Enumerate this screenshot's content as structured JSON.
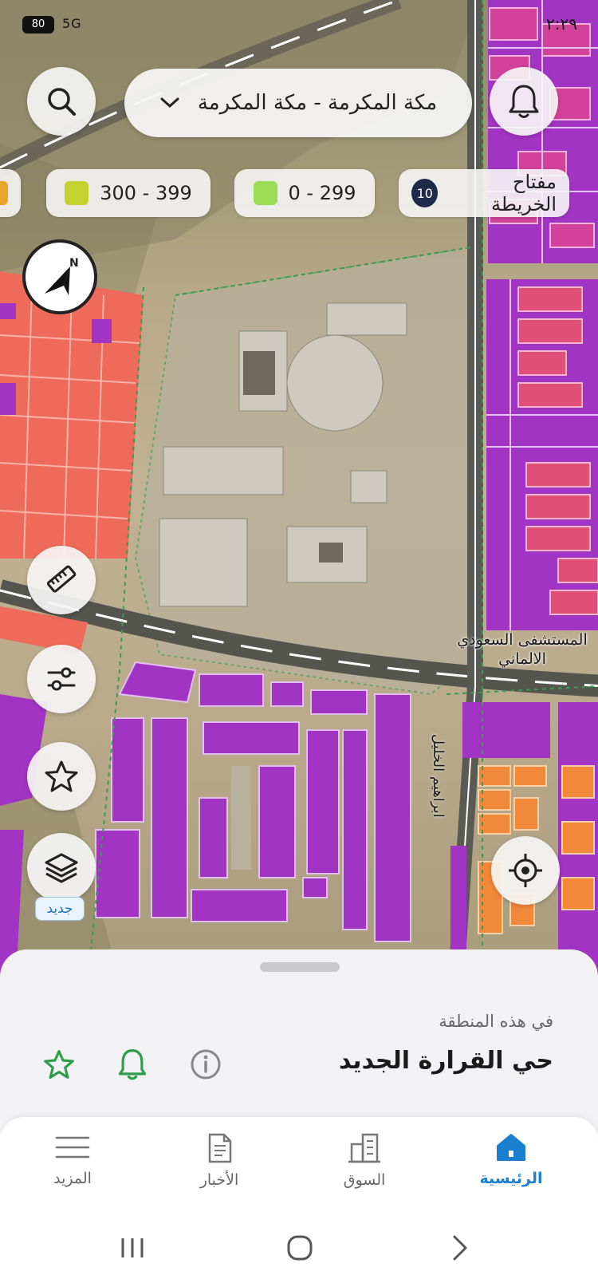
{
  "status_bar": {
    "time": "٢:٢٩",
    "battery": "80",
    "signal": "5G"
  },
  "search": {
    "icon": "search-icon"
  },
  "city_selector": {
    "label": "مكة المكرمة - مكة المكرمة",
    "icon": "chevron-down-icon"
  },
  "notifications": {
    "icon": "bell-icon"
  },
  "legend": {
    "key_label": "مفتاح الخريطة",
    "key_count": "10",
    "ranges": [
      {
        "label": "0 - 299",
        "color": "#9bdc55"
      },
      {
        "label": "300 - 399",
        "color": "#c5d12f"
      }
    ]
  },
  "map": {
    "compass_letter": "N",
    "hospital_label": "المستشفى السعودي الالماني",
    "street_label": "ابراهيم الخليل",
    "colors": {
      "purple": "#a234c4",
      "magenta": "#d2429a",
      "salmon": "#ee6a5a",
      "orange": "#f2883a",
      "zone_border": "#4aa05a"
    }
  },
  "side_tools": {
    "ruler": "ruler-icon",
    "filter": "sliders-icon",
    "favorite": "star-icon",
    "layers": "layers-icon",
    "new_badge": "جديد"
  },
  "locate": {
    "icon": "crosshair-icon"
  },
  "sheet": {
    "subtitle": "في هذه المنطقة",
    "title": "حي القرارة الجديد"
  },
  "tabs": [
    {
      "label": "الرئيسية",
      "icon": "home-icon",
      "active": true
    },
    {
      "label": "السوق",
      "icon": "buildings-icon",
      "active": false
    },
    {
      "label": "الأخبار",
      "icon": "news-icon",
      "active": false
    },
    {
      "label": "المزيد",
      "icon": "menu-icon",
      "active": false
    }
  ],
  "accent": "#1a7fd0"
}
